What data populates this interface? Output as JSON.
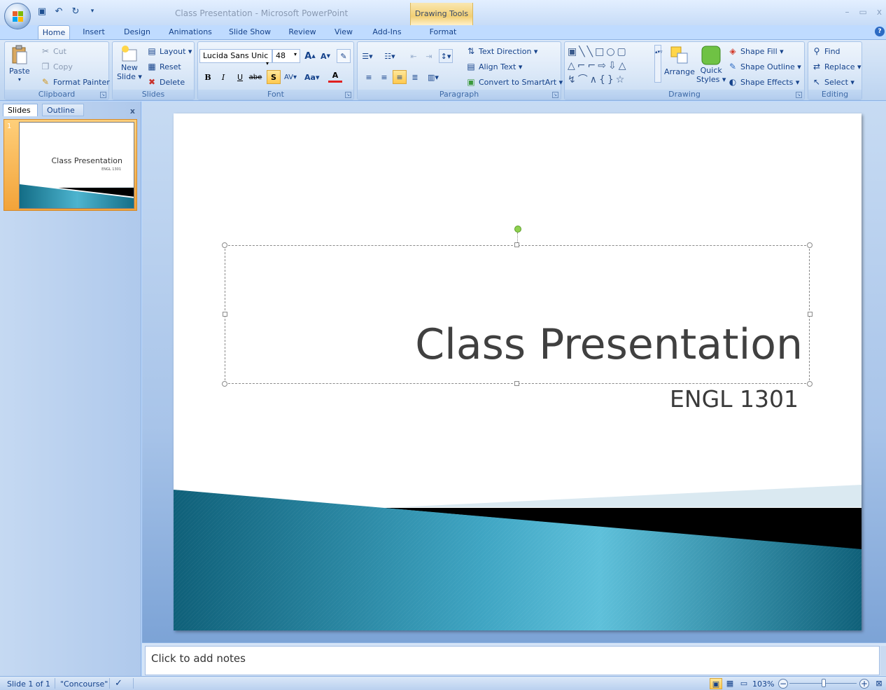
{
  "window": {
    "title": "Class Presentation - Microsoft PowerPoint",
    "context_tab": "Drawing Tools",
    "controls": [
      "–",
      "▭",
      "x"
    ]
  },
  "tabs": [
    "Home",
    "Insert",
    "Design",
    "Animations",
    "Slide Show",
    "Review",
    "View",
    "Add-Ins",
    "Format"
  ],
  "active_tab": "Home",
  "ribbon": {
    "clipboard": {
      "label": "Clipboard",
      "paste": "Paste",
      "cut": "Cut",
      "copy": "Copy",
      "format_painter": "Format Painter"
    },
    "slides": {
      "label": "Slides",
      "new_slide": "New",
      "new_slide2": "Slide ▾",
      "layout": "Layout ▾",
      "reset": "Reset",
      "delete": "Delete"
    },
    "font": {
      "label": "Font",
      "font_name": "Lucida Sans Unic",
      "font_size": "48",
      "bold": "B",
      "italic": "I",
      "underline": "U",
      "strike": "abe",
      "shadow": "S",
      "spacing": "AV",
      "case": "Aa",
      "color": "A"
    },
    "paragraph": {
      "label": "Paragraph",
      "text_direction": "Text Direction ▾",
      "align_text": "Align Text ▾",
      "convert_smartart": "Convert to SmartArt ▾"
    },
    "drawing": {
      "label": "Drawing",
      "arrange": "Arrange",
      "quick_styles": "Quick",
      "quick_styles2": "Styles ▾",
      "shape_fill": "Shape Fill ▾",
      "shape_outline": "Shape Outline ▾",
      "shape_effects": "Shape Effects ▾"
    },
    "editing": {
      "label": "Editing",
      "find": "Find",
      "replace": "Replace ▾",
      "select": "Select ▾"
    }
  },
  "left_pane": {
    "tab_slides": "Slides",
    "tab_outline": "Outline",
    "close": "x",
    "thumbnail": {
      "number": "1",
      "title": "Class Presentation",
      "subtitle": "ENGL 1301"
    }
  },
  "slide": {
    "title": "Class Presentation",
    "subtitle": "ENGL 1301"
  },
  "notes": {
    "placeholder": "Click to add notes"
  },
  "statusbar": {
    "slide_count": "Slide 1 of 1",
    "theme": "\"Concourse\"",
    "zoom": "103%"
  },
  "colors": {
    "ribbon_bg": "#c5daf3",
    "accent_teal": "#1b7a93",
    "selection_orange": "#f2a339"
  }
}
